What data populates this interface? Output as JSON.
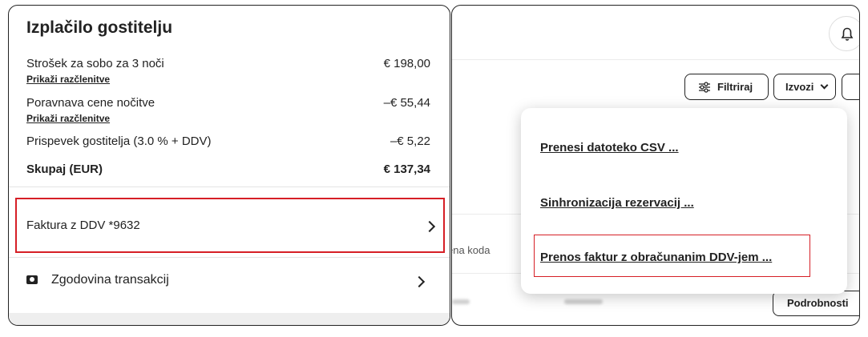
{
  "payout": {
    "title": "Izplačilo gostitelju",
    "lines": [
      {
        "label": "Strošek za sobo za 3 noči",
        "value": "€ 198,00",
        "link": "Prikaži razčlenitve"
      },
      {
        "label": "Poravnava cene nočitve",
        "value": "–€ 55,44",
        "link": "Prikaži razčlenitve"
      },
      {
        "label": "Prispevek gostitelja (3.0 % + DDV)",
        "value": "–€ 5,22"
      }
    ],
    "total": {
      "label": "Skupaj (EUR)",
      "value": "€ 137,34"
    },
    "invoice_label": "Faktura z DDV *9632",
    "history_label": "Zgodovina transakcij"
  },
  "toolbar": {
    "filter_label": "Filtriraj",
    "export_label": "Izvozi"
  },
  "table": {
    "code_column_partial": "ena koda",
    "details_button": "Podrobnosti"
  },
  "export_menu": {
    "items": [
      "Prenesi datoteko CSV ...",
      "Sinhronizacija rezervacij ...",
      "Prenos faktur z obračunanim DDV-jem ..."
    ]
  },
  "colors": {
    "highlight_red": "#d61f26",
    "text": "#222222"
  },
  "icons": [
    "chevron-right-icon",
    "cash-icon",
    "bell-icon",
    "filter-sliders-icon",
    "chevron-down-icon"
  ]
}
